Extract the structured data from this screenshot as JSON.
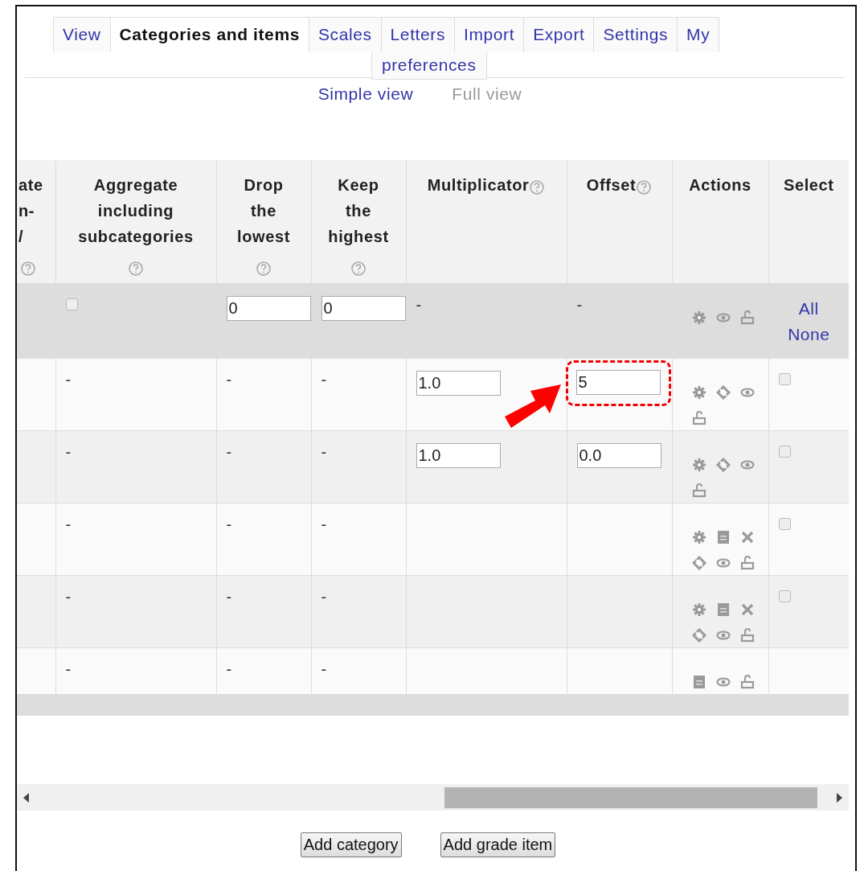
{
  "tabs": [
    {
      "label": "View",
      "selected": false
    },
    {
      "label": "Categories and items",
      "selected": true
    },
    {
      "label": "Scales",
      "selected": false
    },
    {
      "label": "Letters",
      "selected": false
    },
    {
      "label": "Import",
      "selected": false
    },
    {
      "label": "Export",
      "selected": false
    },
    {
      "label": "Settings",
      "selected": false
    },
    {
      "label": "My",
      "continuation": "preferences",
      "selected": false
    }
  ],
  "views": [
    {
      "label": "Simple view",
      "selected": false
    },
    {
      "label": "Full view",
      "selected": true
    }
  ],
  "table": {
    "columns": [
      {
        "label": "ate n- /",
        "help_icon": {
          "kind": "below"
        }
      },
      {
        "label": "Aggregate including subcategories",
        "help_icon": {
          "kind": "below"
        }
      },
      {
        "label": "Drop the lowest",
        "help_icon": {
          "kind": "below"
        }
      },
      {
        "label": "Keep the highest",
        "help_icon": {
          "kind": "below"
        }
      },
      {
        "label": "Multiplicator",
        "help_icon": {
          "kind": "inline"
        }
      },
      {
        "label": "Offset",
        "help_icon": {
          "kind": "inline"
        }
      },
      {
        "label": "Actions"
      },
      {
        "label": "Select"
      }
    ],
    "rows": [
      {
        "kind": "category",
        "cells": [
          {
            "kind": "empty"
          },
          {
            "kind": "checkbox",
            "checked": false
          },
          {
            "kind": "input",
            "value": "0",
            "highlighted": false
          },
          {
            "kind": "input",
            "value": "0",
            "highlighted": false
          },
          {
            "kind": "text",
            "text": "-"
          },
          {
            "kind": "text",
            "text": "-"
          },
          {
            "kind": "actions",
            "icons": [
              {
                "kind": "gear"
              },
              {
                "kind": "eye"
              },
              {
                "kind": "lock"
              }
            ]
          },
          {
            "kind": "links",
            "links": [
              "All",
              "None"
            ]
          }
        ]
      },
      {
        "kind": "item",
        "cells": [
          {
            "kind": "empty"
          },
          {
            "kind": "text",
            "text": "-"
          },
          {
            "kind": "text",
            "text": "-"
          },
          {
            "kind": "text",
            "text": "-"
          },
          {
            "kind": "input",
            "value": "1.0",
            "highlighted": false
          },
          {
            "kind": "input",
            "value": "5",
            "highlighted": true
          },
          {
            "kind": "actions",
            "icons": [
              {
                "kind": "gear"
              },
              {
                "kind": "move"
              },
              {
                "kind": "eye"
              },
              {
                "kind": "lock"
              }
            ]
          },
          {
            "kind": "checkbox",
            "checked": false
          }
        ]
      },
      {
        "kind": "item",
        "cells": [
          {
            "kind": "empty"
          },
          {
            "kind": "text",
            "text": "-"
          },
          {
            "kind": "text",
            "text": "-"
          },
          {
            "kind": "text",
            "text": "-"
          },
          {
            "kind": "input",
            "value": "1.0",
            "highlighted": false
          },
          {
            "kind": "input",
            "value": "0.0",
            "highlighted": false
          },
          {
            "kind": "actions",
            "icons": [
              {
                "kind": "gear"
              },
              {
                "kind": "move"
              },
              {
                "kind": "eye"
              },
              {
                "kind": "lock"
              }
            ]
          },
          {
            "kind": "checkbox",
            "checked": false
          }
        ]
      },
      {
        "kind": "item",
        "cells": [
          {
            "kind": "empty"
          },
          {
            "kind": "text",
            "text": "-"
          },
          {
            "kind": "text",
            "text": "-"
          },
          {
            "kind": "text",
            "text": "-"
          },
          {
            "kind": "empty"
          },
          {
            "kind": "empty"
          },
          {
            "kind": "actions",
            "icons": [
              {
                "kind": "gear"
              },
              {
                "kind": "calculator"
              },
              {
                "kind": "delete"
              },
              {
                "kind": "move"
              },
              {
                "kind": "eye"
              },
              {
                "kind": "lock"
              }
            ]
          },
          {
            "kind": "checkbox",
            "checked": false
          }
        ]
      },
      {
        "kind": "item",
        "cells": [
          {
            "kind": "empty"
          },
          {
            "kind": "text",
            "text": "-"
          },
          {
            "kind": "text",
            "text": "-"
          },
          {
            "kind": "text",
            "text": "-"
          },
          {
            "kind": "empty"
          },
          {
            "kind": "empty"
          },
          {
            "kind": "actions",
            "icons": [
              {
                "kind": "gear"
              },
              {
                "kind": "calculator"
              },
              {
                "kind": "delete"
              },
              {
                "kind": "move"
              },
              {
                "kind": "eye"
              },
              {
                "kind": "lock"
              }
            ]
          },
          {
            "kind": "checkbox",
            "checked": false
          }
        ]
      },
      {
        "kind": "item",
        "cells": [
          {
            "kind": "empty"
          },
          {
            "kind": "text",
            "text": "-"
          },
          {
            "kind": "text",
            "text": "-"
          },
          {
            "kind": "text",
            "text": "-"
          },
          {
            "kind": "empty"
          },
          {
            "kind": "empty"
          },
          {
            "kind": "actions",
            "icons": [
              {
                "kind": "calculator"
              },
              {
                "kind": "eye"
              },
              {
                "kind": "lock"
              }
            ]
          },
          {
            "kind": "empty"
          }
        ]
      }
    ]
  },
  "buttons": [
    "Add category",
    "Add grade item"
  ]
}
